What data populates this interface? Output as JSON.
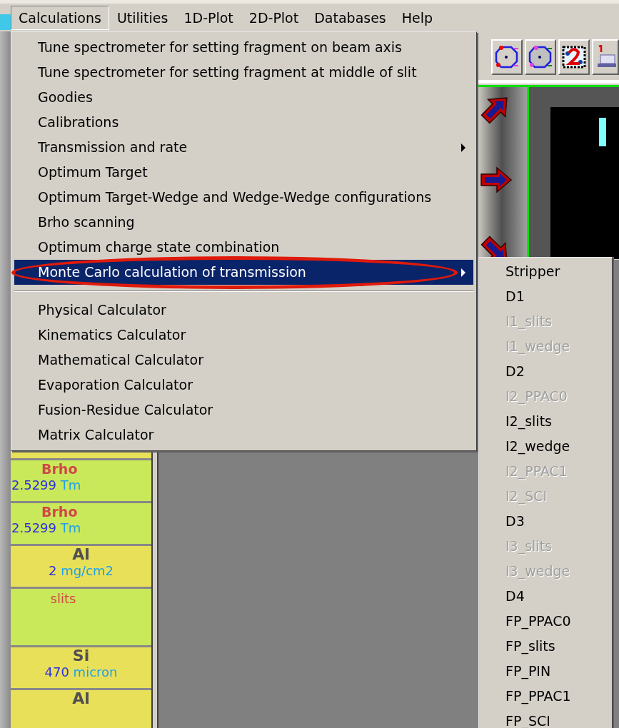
{
  "menubar": [
    {
      "label": "Calculations",
      "selected": true
    },
    {
      "label": "Utilities",
      "selected": false
    },
    {
      "label": "1D-Plot",
      "selected": false
    },
    {
      "label": "2D-Plot",
      "selected": false
    },
    {
      "label": "Databases",
      "selected": false
    },
    {
      "label": "Help",
      "selected": false
    }
  ],
  "menu": {
    "items": [
      {
        "kind": "item",
        "label": "Tune spectrometer for setting fragment on beam axis",
        "has_submenu": false,
        "selected": false
      },
      {
        "kind": "item",
        "label": "Tune spectrometer for setting fragment at middle of slit",
        "has_submenu": false,
        "selected": false
      },
      {
        "kind": "item",
        "label": "Goodies",
        "has_submenu": false,
        "selected": false
      },
      {
        "kind": "item",
        "label": "Calibrations",
        "has_submenu": false,
        "selected": false
      },
      {
        "kind": "item",
        "label": "Transmission and rate",
        "has_submenu": true,
        "selected": false
      },
      {
        "kind": "item",
        "label": "Optimum Target",
        "has_submenu": false,
        "selected": false
      },
      {
        "kind": "item",
        "label": "Optimum Target-Wedge and Wedge-Wedge configurations",
        "has_submenu": false,
        "selected": false
      },
      {
        "kind": "item",
        "label": "Brho scanning",
        "has_submenu": false,
        "selected": false
      },
      {
        "kind": "item",
        "label": "Optimum charge state combination",
        "has_submenu": false,
        "selected": false
      },
      {
        "kind": "item",
        "label": "Monte Carlo calculation of transmission",
        "has_submenu": true,
        "selected": true,
        "circled": true
      },
      {
        "kind": "separator"
      },
      {
        "kind": "item",
        "label": "Physical Calculator",
        "has_submenu": false,
        "selected": false
      },
      {
        "kind": "item",
        "label": "Kinematics Calculator",
        "has_submenu": false,
        "selected": false
      },
      {
        "kind": "item",
        "label": "Mathematical Calculator",
        "has_submenu": false,
        "selected": false
      },
      {
        "kind": "item",
        "label": "Evaporation Calculator",
        "has_submenu": false,
        "selected": false
      },
      {
        "kind": "item",
        "label": "Fusion-Residue Calculator",
        "has_submenu": false,
        "selected": false
      },
      {
        "kind": "item",
        "label": "Matrix Calculator",
        "has_submenu": false,
        "selected": false
      }
    ]
  },
  "submenu": {
    "items": [
      {
        "label": "Stripper",
        "disabled": false
      },
      {
        "label": "D1",
        "disabled": false
      },
      {
        "label": "I1_slits",
        "disabled": true
      },
      {
        "label": "I1_wedge",
        "disabled": true
      },
      {
        "label": "D2",
        "disabled": false
      },
      {
        "label": "I2_PPAC0",
        "disabled": true
      },
      {
        "label": "I2_slits",
        "disabled": false
      },
      {
        "label": "I2_wedge",
        "disabled": false
      },
      {
        "label": "I2_PPAC1",
        "disabled": true
      },
      {
        "label": "I2_SCI",
        "disabled": true
      },
      {
        "label": "D3",
        "disabled": false
      },
      {
        "label": "I3_slits",
        "disabled": true
      },
      {
        "label": "I3_wedge",
        "disabled": true
      },
      {
        "label": "D4",
        "disabled": false
      },
      {
        "label": "FP_PPAC0",
        "disabled": false
      },
      {
        "label": "FP_slits",
        "disabled": false
      },
      {
        "label": "FP_PIN",
        "disabled": false
      },
      {
        "label": "FP_PPAC1",
        "disabled": false
      },
      {
        "label": "FP_SCI",
        "disabled": false
      }
    ]
  },
  "side_cells": [
    {
      "kind": "magnet",
      "title": "Brho",
      "value": "2.5299",
      "unit": "Tm"
    },
    {
      "kind": "magnet",
      "title": "Brho",
      "value": "2.5299",
      "unit": "Tm"
    },
    {
      "kind": "material",
      "title": "Al",
      "value": "2",
      "unit": "mg/cm2"
    },
    {
      "kind": "slits",
      "title": "slits"
    },
    {
      "kind": "material",
      "title": "Si",
      "value": "470",
      "unit": "micron"
    },
    {
      "kind": "material",
      "title": "Al"
    }
  ]
}
